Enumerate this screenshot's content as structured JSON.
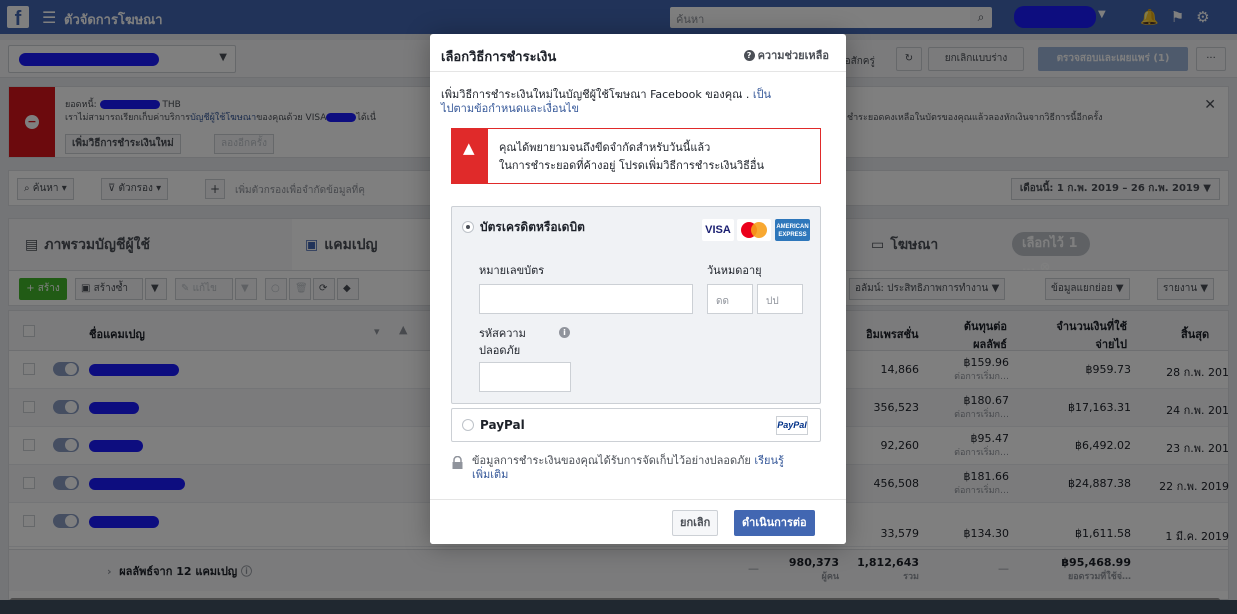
{
  "topbar": {
    "logo": "f",
    "menu_icon": "hamburger-icon",
    "title": "ตัวจัดการโฆษณา",
    "search_placeholder": "ค้นหา"
  },
  "bar2": {
    "last_edit": "มื่อสักครู่",
    "discard_label": "ยกเลิกแบบร่าง",
    "review_label": "ตรวจสอบและเผยแพร่ (1)",
    "more_label": "···"
  },
  "alert": {
    "balance_prefix": "ยอดหนี้:",
    "currency": "THB",
    "line2_prefix": "เราไม่สามารถเรียกเก็บค่าบริการ",
    "line2_link": "บัญชีผู้ใช้โฆษณา",
    "line2_mid": "ของคุณด้วย VISA",
    "line2_suffix": "ได้เนื่",
    "line2_right": "ชำระยอดคงเหลือในบัตรของคุณแล้วลองหักเงินจากวิธีการนี้อีกครั้ง",
    "add_method": "เพิ่มวิธีการชำระเงินใหม่",
    "retry": "ลองอีกครั้ง"
  },
  "filters": {
    "search": "ค้นหา",
    "filter": "ตัวกรอง",
    "plus": "+",
    "placeholder": "เพิ่มตัวกรองเพื่อจำกัดข้อมูลที่คุ",
    "date_range": "เดือนนี้: 1 ก.พ. 2019 – 26 ก.พ. 2019"
  },
  "tabs": {
    "account": "ภาพรวมบัญชีผู้ใช้",
    "campaigns": "แคมเปญ",
    "ads": "โฆษณา",
    "selected": "เลือกไว้ 1 …"
  },
  "toolbar": {
    "create": "+ สร้าง",
    "duplicate": "สร้างซ้ำ",
    "edit": "แก้ไข",
    "columns": "อลัมน์: ประสิทธิภาพการทำงาน",
    "breakdown": "ข้อมูลแยกย่อย",
    "reports": "รายงาน"
  },
  "table": {
    "headers": {
      "name": "ชื่อแคมเปญ",
      "impressions": "อิมเพรสชั่น",
      "cpr_line1": "ต้นทุนต่อ",
      "cpr_line2": "ผลลัพธ์",
      "spent_line1": "จำนวนเงินที่ใช้",
      "spent_line2": "จ่ายไป",
      "ends": "สิ้นสุด"
    },
    "rows": [
      {
        "impressions": "14,866",
        "cpr": "฿159.96",
        "cpr_sub": "ต่อการเริ่มก…",
        "spent": "฿959.73",
        "ends": "28 ก.พ. 201"
      },
      {
        "impressions": "356,523",
        "cpr": "฿180.67",
        "cpr_sub": "ต่อการเริ่มก…",
        "spent": "฿17,163.31",
        "ends": "24 ก.พ. 201"
      },
      {
        "impressions": "92,260",
        "cpr": "฿95.47",
        "cpr_sub": "ต่อการเริ่มก…",
        "spent": "฿6,492.02",
        "ends": "23 ก.พ. 201"
      },
      {
        "impressions": "456,508",
        "cpr": "฿181.66",
        "cpr_sub": "ต่อการเริ่มก…",
        "spent": "฿24,887.38",
        "ends": "22 ก.พ. 2019"
      },
      {
        "impressions": "33,579",
        "cpr": "฿134.30",
        "cpr_sub": "",
        "spent": "฿1,611.58",
        "ends": "1 มี.ค. 2019"
      }
    ],
    "total": {
      "label": "ผลลัพธ์จาก 12 แคมเปญ",
      "dash": "—",
      "reach": "980,373",
      "reach_sub": "ผู้คน",
      "impressions": "1,812,643",
      "impressions_sub": "รวม",
      "dash2": "—",
      "spent": "฿95,468.99",
      "spent_sub": "ยอดรวมที่ใช้จ่…"
    }
  },
  "modal": {
    "title": "เลือกวิธีการชำระเงิน",
    "help": "ความช่วยเหลือ",
    "intro_text": "เพิ่มวิธีการชำระเงินใหม่ในบัญชีผู้ใช้โฆษณา Facebook ของคุณ .",
    "intro_link_1": "เป็น",
    "intro_link_2": "ไปตามข้อกำหนดและเงื่อนไข",
    "error_line1": "คุณได้พยายามจนถึงขีดจำกัดสำหรับวันนี้แล้ว",
    "error_line2": "ในการชำระยอดที่ค้างอยู่ โปรดเพิ่มวิธีการชำระเงินวิธีอื่น",
    "card_option": "บัตรเครดิตหรือเดบิต",
    "brand_visa": "VISA",
    "brand_amex": "AMERICAN EXPRESS",
    "card_number_label": "หมายเลขบัตร",
    "expiry_label": "วันหมดอายุ",
    "expiry_month_ph": "ดด",
    "expiry_year_ph": "ปป",
    "cvv_label_1": "รหัสความ",
    "cvv_label_2": "ปลอดภัย",
    "paypal_option": "PayPal",
    "paypal_logo": "PayPal",
    "secure_text": "ข้อมูลการชำระเงินของคุณได้รับการจัดเก็บไว้อย่างปลอดภัย",
    "secure_link_1": "เรียนรู้",
    "secure_link_2": "เพิ่มเติม",
    "cancel": "ยกเลิก",
    "continue": "ดำเนินการต่อ"
  }
}
